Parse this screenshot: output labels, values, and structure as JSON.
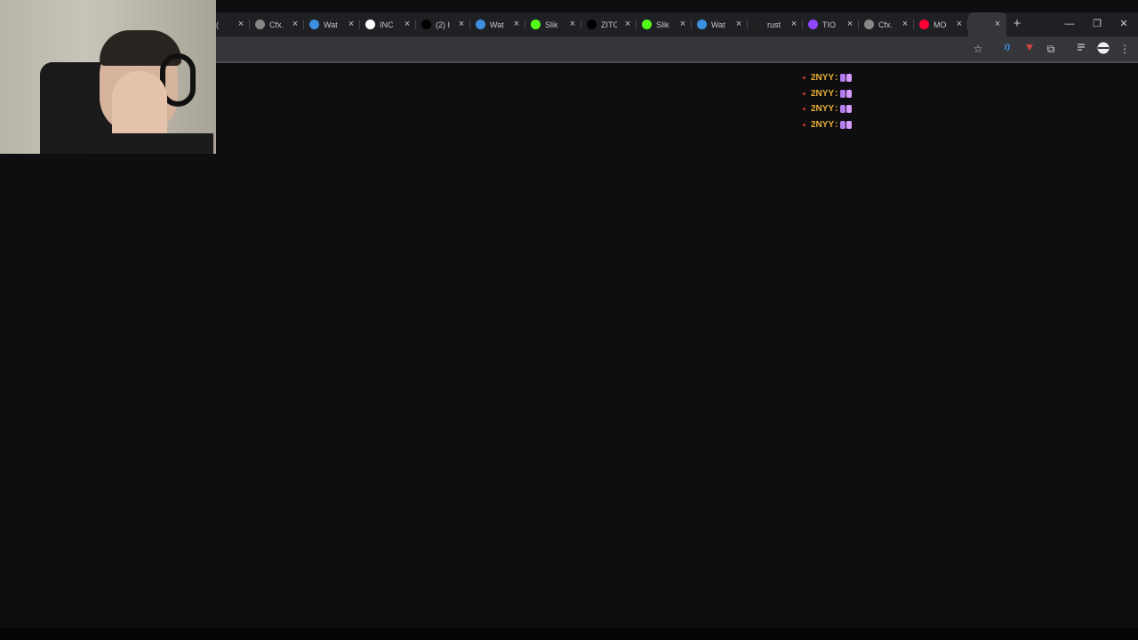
{
  "browser": {
    "tabs": [
      {
        "title": "(",
        "icon": "generic-icon",
        "color": "#888888",
        "active": false
      },
      {
        "title": "Cfx.",
        "icon": "globe-icon",
        "color": "#888888",
        "active": false
      },
      {
        "title": "Wat",
        "icon": "watch-icon",
        "color": "#3d8fe0",
        "active": false
      },
      {
        "title": "INC",
        "icon": "google-icon",
        "color": "#ffffff",
        "active": false
      },
      {
        "title": "(2) I",
        "icon": "x-icon",
        "color": "#000000",
        "active": false
      },
      {
        "title": "Wat",
        "icon": "watch-icon",
        "color": "#3d8fe0",
        "active": false
      },
      {
        "title": "Slik",
        "icon": "kick-icon",
        "color": "#53fc18",
        "active": false
      },
      {
        "title": "ZITC",
        "icon": "tiktok-icon",
        "color": "#000000",
        "active": false
      },
      {
        "title": "Slik",
        "icon": "kick-icon",
        "color": "#53fc18",
        "active": false
      },
      {
        "title": "Wat",
        "icon": "watch-icon",
        "color": "#3d8fe0",
        "active": false
      },
      {
        "title": "rust",
        "icon": "rust-icon",
        "color": "#222222",
        "active": false
      },
      {
        "title": "TIO",
        "icon": "twitch-icon",
        "color": "#9146ff",
        "active": false
      },
      {
        "title": "Cfx.",
        "icon": "globe-icon",
        "color": "#888888",
        "active": false
      },
      {
        "title": "MO",
        "icon": "youtube-icon",
        "color": "#ff0033",
        "active": false
      },
      {
        "title": "",
        "icon": "blank-icon",
        "color": "#35363a",
        "active": true
      }
    ],
    "close_glyph": "×",
    "new_tab_glyph": "+",
    "window": {
      "minimize": "—",
      "restore": "❐",
      "close": "✕"
    },
    "toolbar": {
      "bookmark": "☆",
      "extensions": "⧉",
      "menu": "⋮"
    }
  },
  "chat": {
    "messages": [
      {
        "user": "2NYY",
        "separator": ":",
        "emote": "emote-icon"
      },
      {
        "user": "2NYY",
        "separator": ":",
        "emote": "emote-icon"
      },
      {
        "user": "2NYY",
        "separator": ":",
        "emote": "emote-icon"
      },
      {
        "user": "2NYY",
        "separator": ":",
        "emote": "emote-icon"
      }
    ],
    "user_color": "#e6b030",
    "emote_color": "#b57cf0"
  },
  "page": {
    "background": "#0e0e10"
  }
}
